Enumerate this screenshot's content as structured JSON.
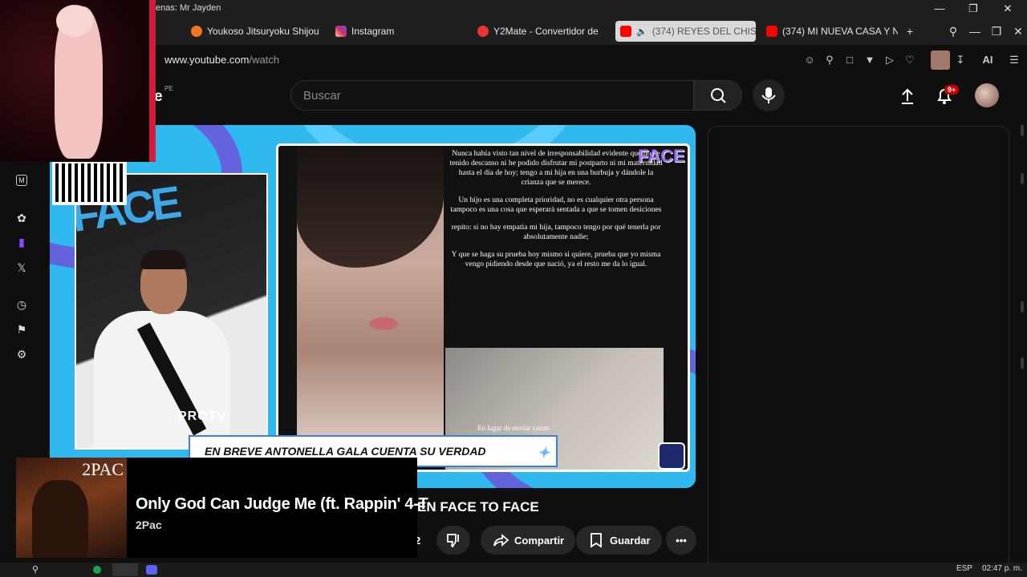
{
  "window": {
    "title": "enas: Mr Jayden"
  },
  "tabs": [
    {
      "label": "Youkoso Jitsuryoku Shijou",
      "icon": "crunchyroll-icon",
      "color": "#f47521"
    },
    {
      "label": "Instagram",
      "icon": "instagram-icon",
      "color": "#d6249f"
    },
    {
      "label": "Y2Mate - Convertidor de",
      "icon": "y2mate-icon",
      "color": "#e33"
    },
    {
      "label": "(374) REYES DEL CHIS",
      "icon": "youtube-icon",
      "color": "#ff0000",
      "active": true
    },
    {
      "label": "(374) MI NUEVA CASA Y N",
      "icon": "youtube-icon",
      "color": "#ff0000"
    }
  ],
  "address": {
    "domain": "www.youtube.com",
    "path": "/watch"
  },
  "extensions": {
    "ai_label": "AI"
  },
  "youtube": {
    "region": "PE",
    "logo_partial": "e",
    "search_placeholder": "Buscar",
    "notifications_badge": "9+"
  },
  "video": {
    "banner_text": "EN BREVE ANTONELLA GALA CUENTA SU VERDAD",
    "watermark": "PROTV",
    "logo_text": "FACE",
    "statement_paragraphs": [
      "Nunca había visto tan nivel de irresponsabilidad evidente que no he tenido descanso ni he podido disfrutar mi postparto ni mi maternidad hasta el día de hoy; tengo a mi hija en una burbuja y dándole la crianza que se merece.",
      "Un hijo es una completa prioridad, no es cualquier otra persona tampoco es una cosa que esperará sentada a que se tomen desiciones",
      "repito: si no hay empatía mi hija, tampoco tengo por qué tenerla por absolutamente nadie;",
      "Y que se haga su prueba hoy mismo si quiere, prueba que yo misma vengo pidiendo desde que nació, ya el resto me da lo igual."
    ],
    "photo_caption": "En lugar de enviar cartas",
    "title_visible": "EN FACE TO FACE"
  },
  "actions": {
    "like_count": "2",
    "share_label": "Compartir",
    "save_label": "Guardar"
  },
  "music": {
    "album_text": "2PAC",
    "song": "Only God Can Judge Me (ft. Rappin' 4-T",
    "artist": "2Pac"
  },
  "taskbar": {
    "lang": "ESP",
    "time": "02:47 p. m."
  }
}
